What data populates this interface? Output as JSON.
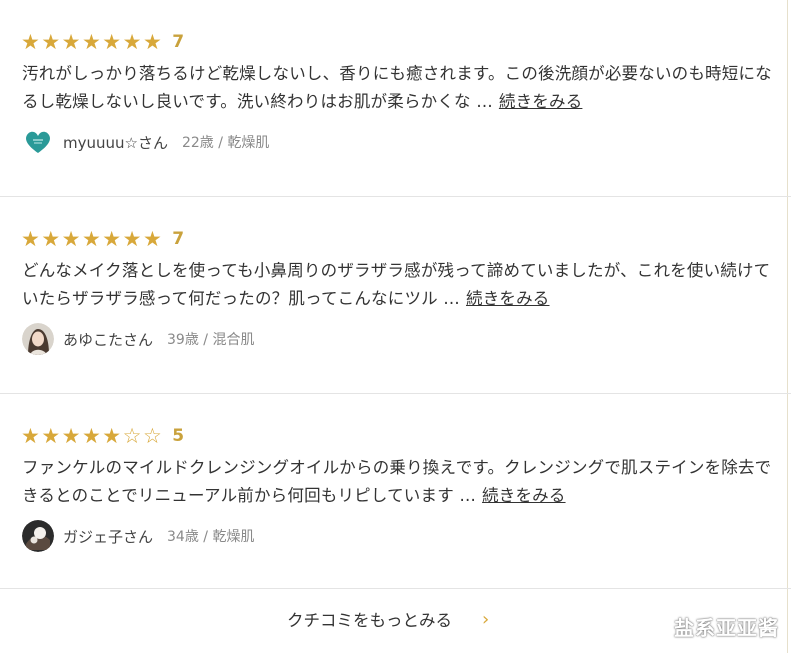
{
  "colors": {
    "star": "#d8a83a",
    "score": "#c9a23c",
    "divider": "#e4e4e4"
  },
  "reviews": [
    {
      "stars": "★★★★★★★",
      "score": "7",
      "text": "汚れがしっかり落ちるけど乾燥しないし、香りにも癒されます。この後洗顔が必要ないのも時短になるし乾燥しないし良いです。洗い終わりはお肌が柔らかくな …",
      "more": "続きをみる",
      "username": "myuuuu☆さん",
      "meta": "22歳 / 乾燥肌",
      "avatar_icon": "heart-avatar-icon"
    },
    {
      "stars": "★★★★★★★",
      "score": "7",
      "text": "どんなメイク落としを使っても小鼻周りのザラザラ感が残って諦めていましたが、これを使い続けていたらザラザラ感って何だったの？肌ってこんなにツル …",
      "more": "続きをみる",
      "username": "あゆこたさん",
      "meta": "39歳 / 混合肌",
      "avatar_icon": "portrait-avatar-icon"
    },
    {
      "stars": "★★★★★☆☆",
      "score": "5",
      "text": "ファンケルのマイルドクレンジングオイルからの乗り換えです。クレンジングで肌ステインを除去できるとのことでリニューアル前から何回もリピしています …",
      "more": "続きをみる",
      "username": "ガジェ子さん",
      "meta": "34歳 / 乾燥肌",
      "avatar_icon": "photo-avatar-icon"
    }
  ],
  "footer": {
    "more_reviews": "クチコミをもっとみる",
    "chevron": "›"
  },
  "watermark": "盐系亚亚酱"
}
